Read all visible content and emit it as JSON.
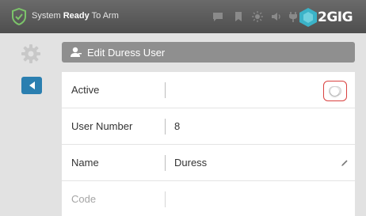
{
  "status_bar": {
    "prefix": "System ",
    "ready": "Ready",
    "suffix": " To Arm",
    "icons": [
      "shield-check-icon",
      "message-icon",
      "bookmark-icon",
      "sun-icon",
      "speaker-icon",
      "plug-icon"
    ],
    "logo": "2GIG"
  },
  "sidebar": {
    "icons": [
      "gear-icon",
      "back-arrow-icon"
    ]
  },
  "header": {
    "icon": "user-icon",
    "title": "Edit Duress User"
  },
  "form": {
    "rows": [
      {
        "label": "Active",
        "value": "",
        "control": "toggle",
        "toggle_on": false
      },
      {
        "label": "User Number",
        "value": "8"
      },
      {
        "label": "Name",
        "value": "Duress",
        "control": "pencil-icon"
      },
      {
        "label": "Code",
        "value": ""
      }
    ]
  },
  "colors": {
    "status_bar": "#5a5a5a",
    "accent_blue": "#2b7fb0",
    "highlight_red": "#d9413f",
    "shield_green": "#7cc46a",
    "logo_teal": "#3bb3c8"
  }
}
